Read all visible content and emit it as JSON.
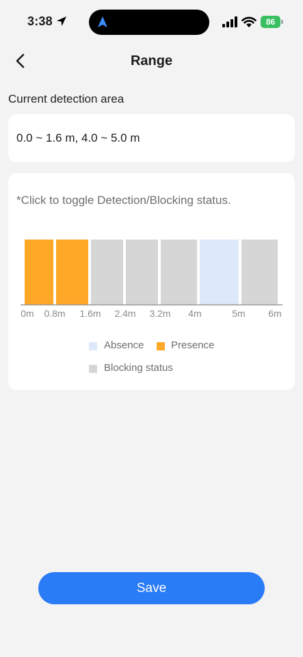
{
  "status_bar": {
    "time": "3:38",
    "battery": "86"
  },
  "header": {
    "title": "Range"
  },
  "detection": {
    "label": "Current detection area",
    "value": "0.0 ~ 1.6 m, 4.0 ~ 5.0 m"
  },
  "chart_card": {
    "hint": "*Click to toggle Detection/Blocking status."
  },
  "chart_data": {
    "type": "bar",
    "x_ticks": [
      "0m",
      "0.8m",
      "1.6m",
      "2.4m",
      "3.2m",
      "4m",
      "5m",
      "6m"
    ],
    "segments": [
      {
        "start": 0.0,
        "end": 0.8,
        "status": "Presence"
      },
      {
        "start": 0.8,
        "end": 1.6,
        "status": "Presence"
      },
      {
        "start": 1.6,
        "end": 2.4,
        "status": "Blocking status"
      },
      {
        "start": 2.4,
        "end": 3.2,
        "status": "Blocking status"
      },
      {
        "start": 3.2,
        "end": 4.0,
        "status": "Blocking status"
      },
      {
        "start": 4.0,
        "end": 5.0,
        "status": "Absence"
      },
      {
        "start": 5.0,
        "end": 6.0,
        "status": "Blocking status"
      }
    ],
    "legend": [
      {
        "label": "Absence",
        "color": "#dde8fb"
      },
      {
        "label": "Presence",
        "color": "#ffa726"
      },
      {
        "label": "Blocking status",
        "color": "#d6d6d6"
      }
    ]
  },
  "actions": {
    "save_label": "Save"
  },
  "colors": {
    "accent": "#2a7bf6",
    "presence": "#ffa726",
    "absence": "#dde8fb",
    "blocking": "#d6d6d6"
  }
}
